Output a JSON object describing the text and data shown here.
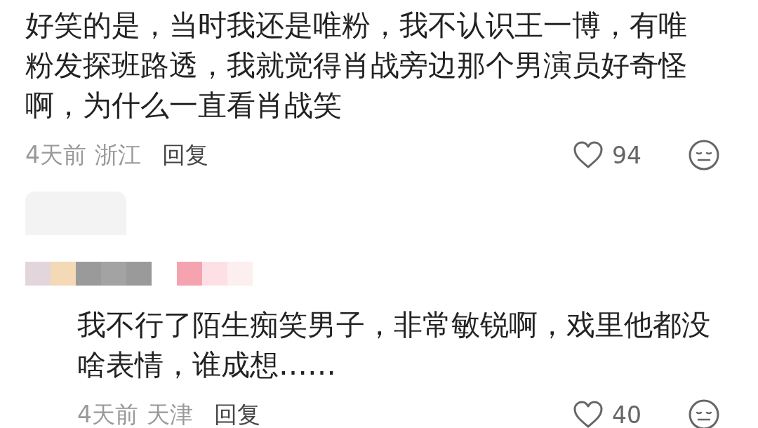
{
  "comments": [
    {
      "text": "好笑的是，当时我还是唯粉，我不认识王一博，有唯粉发探班路透，我就觉得肖战旁边那个男演员好奇怪啊，为什么一直看肖战笑",
      "time": "4天前",
      "location": "浙江",
      "reply_label": "回复",
      "likes": "94",
      "kind": "top"
    },
    {
      "text": "我不行了陌生痴笑男子，非常敏锐啊，戏里他都没啥表情，谁成想……",
      "time": "4天前",
      "location": "天津",
      "reply_label": "回复",
      "likes": "40",
      "kind": "reply"
    }
  ]
}
